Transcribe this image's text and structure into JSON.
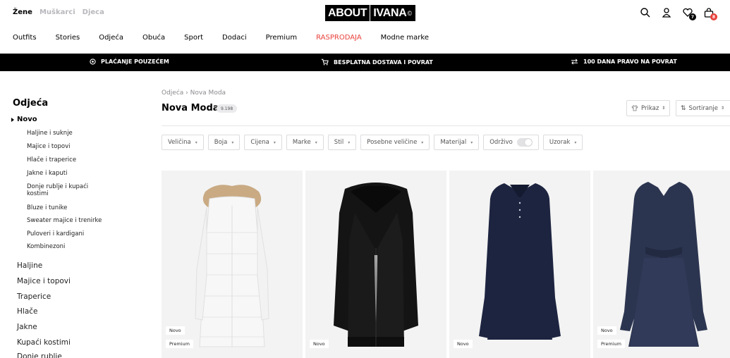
{
  "header": {
    "gender_tabs": [
      {
        "label": "Žene",
        "active": true
      },
      {
        "label": "Muškarci",
        "active": false
      },
      {
        "label": "Djeca",
        "active": false
      }
    ],
    "logo_about": "ABOUT",
    "logo_name": "IVANA",
    "logo_mark": "©",
    "icons": [
      {
        "name": "search-icon"
      },
      {
        "name": "account-icon"
      },
      {
        "name": "wishlist-icon",
        "badge": "7",
        "badge_color": "#000000"
      },
      {
        "name": "basket-icon",
        "badge": "8",
        "badge_color": "#e8413b"
      }
    ]
  },
  "nav": {
    "items": [
      "Outfits",
      "Stories",
      "Odjeća",
      "Obuća",
      "Sport",
      "Dodaci",
      "Premium",
      "RASPRODAJA",
      "Modne marke"
    ],
    "sale_color": "#e8413b"
  },
  "banner": {
    "items": [
      {
        "label": "PLAĆANJE POUZEĆEM",
        "icon": "coin-icon"
      },
      {
        "label": "BESPLATNA DOSTAVA I POVRAT",
        "icon": "cart-icon"
      },
      {
        "label": "100 DANA PRAVO NA POVRAT",
        "icon": "swap-arrows-icon"
      }
    ]
  },
  "sidebar": {
    "title": "Odjeća",
    "active_category": "Novo",
    "subitems": [
      "Haljine i suknje",
      "Majice i topovi",
      "Hlače i traperice",
      "Jakne i kaputi",
      "Donje rublje i kupaći kostimi",
      "Bluze i tunike",
      "Sweater majice i trenirke",
      "Puloveri i kardigani",
      "Kombinezoni"
    ],
    "categories": [
      "Haljine",
      "Majice i topovi",
      "Traperice",
      "Hlače",
      "Jakne",
      "Kupaći kostimi",
      "Donje rublje"
    ]
  },
  "content": {
    "breadcrumb": "Odjeća › Nova Moda",
    "title": "Nova Moda",
    "count": "9.198",
    "view_label": "Prikaz",
    "sort_label": "Sortiranje"
  },
  "filters": [
    {
      "label": "Veličina"
    },
    {
      "label": "Boja"
    },
    {
      "label": "Cijena"
    },
    {
      "label": "Marke"
    },
    {
      "label": "Stil"
    },
    {
      "label": "Posebne veličine"
    },
    {
      "label": "Materijal"
    },
    {
      "label": "Održivo",
      "toggle": true,
      "toggle_on": false
    },
    {
      "label": "Uzorak"
    }
  ],
  "products": [
    {
      "tags": [
        "Novo",
        "Premium"
      ],
      "image": "white-puffer-coat",
      "color": "#f6f6f6"
    },
    {
      "tags": [
        "Novo"
      ],
      "image": "black-aviator-jacket",
      "color": "#111111"
    },
    {
      "tags": [
        "Novo"
      ],
      "image": "navy-polo-dress",
      "color": "#1d2440"
    },
    {
      "tags": [
        "Novo",
        "Premium"
      ],
      "image": "navy-shirt-dress",
      "color": "#2c3550"
    }
  ]
}
